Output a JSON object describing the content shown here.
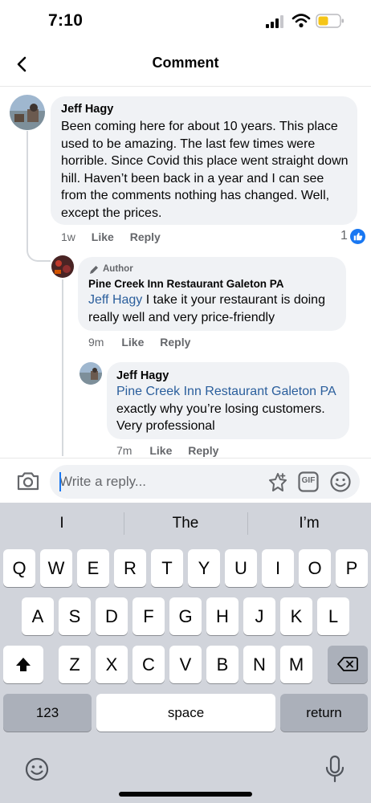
{
  "status_bar": {
    "time": "7:10",
    "icons": [
      "cellular-signal-icon",
      "wifi-icon",
      "battery-low-icon"
    ],
    "battery_color": "#f5c518"
  },
  "header": {
    "title": "Comment",
    "back_icon": "chevron-left-icon"
  },
  "comments": {
    "main": {
      "author": "Jeff Hagy",
      "text": "Been coming here for about 10 years. This place used to be amazing. The last few times were horrible. Since Covid this place went straight down hill. Haven’t been back in a year and I can see from the comments nothing has changed. Well, except the prices.",
      "time": "1w",
      "like_label": "Like",
      "reply_label": "Reply",
      "reaction_count": "1",
      "reaction_icon": "thumbs-up-icon"
    },
    "reply1": {
      "badge_label": "Author",
      "badge_icon": "pencil-icon",
      "author": "Pine Creek Inn Restaurant Galeton PA",
      "mention": "Jeff Hagy",
      "text": " I take it your restaurant is doing really well and very price-friendly",
      "time": "9m",
      "like_label": "Like",
      "reply_label": "Reply"
    },
    "reply2": {
      "author": "Jeff Hagy",
      "mention": "Pine Creek Inn Restaurant Galeton PA",
      "text": "exactly why you’re losing customers. Very professional",
      "time": "7m",
      "like_label": "Like",
      "reply_label": "Reply"
    }
  },
  "reply_bar": {
    "placeholder": "Write a reply...",
    "camera_icon": "camera-icon",
    "sticker_icon": "sticker-icon",
    "gif_label": "GIF",
    "emoji_icon": "smiley-icon"
  },
  "keyboard": {
    "suggestions": [
      "I",
      "The",
      "I’m"
    ],
    "row1": [
      "Q",
      "W",
      "E",
      "R",
      "T",
      "Y",
      "U",
      "I",
      "O",
      "P"
    ],
    "row2": [
      "A",
      "S",
      "D",
      "F",
      "G",
      "H",
      "J",
      "K",
      "L"
    ],
    "row3": [
      "Z",
      "X",
      "C",
      "V",
      "B",
      "N",
      "M"
    ],
    "numbers_label": "123",
    "space_label": "space",
    "return_label": "return",
    "shift_icon": "shift-icon",
    "backspace_icon": "backspace-icon",
    "emoji_icon": "emoji-keyboard-icon",
    "mic_icon": "microphone-icon"
  },
  "colors": {
    "mention": "#2a5e9c",
    "accent": "#1877f2",
    "bubble": "#f0f2f5"
  }
}
